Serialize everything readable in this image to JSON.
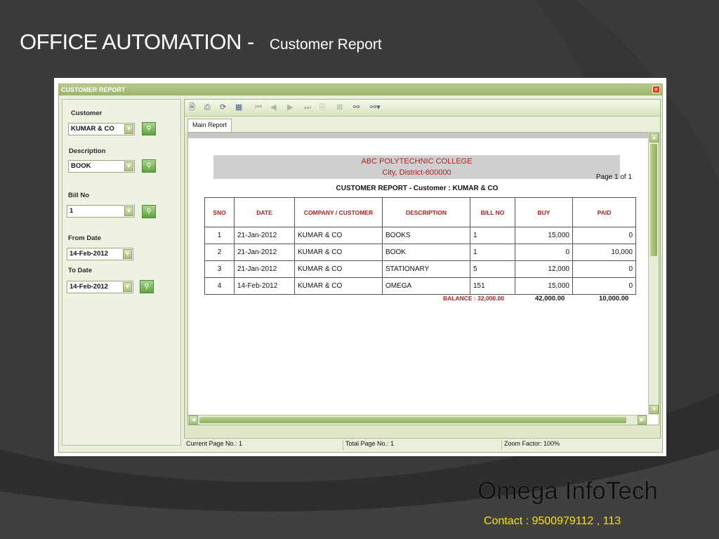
{
  "slide": {
    "title": "OFFICE AUTOMATION -",
    "subtitle": "Customer Report",
    "brand": "Omega  InfoTech",
    "contact": "Contact : 9500979112 , 113"
  },
  "window": {
    "title": "CUSTOMER REPORT",
    "close_glyph": "×"
  },
  "filters": {
    "customer_label": "Customer",
    "customer_value": "KUMAR & CO",
    "description_label": "Description",
    "description_value": "BOOK",
    "bill_no_label": "Bill No",
    "bill_no_value": "1",
    "from_date_label": "From Date",
    "from_date_value": "14-Feb-2012",
    "to_date_label": "To Date",
    "to_date_value": "14-Feb-2012"
  },
  "viewer": {
    "tab_label": "Main Report",
    "toolbar_icons": [
      "export-icon",
      "print-icon",
      "refresh-icon",
      "group-tree-icon",
      "first-page-icon",
      "prev-page-icon",
      "next-page-icon",
      "last-page-icon",
      "goto-page-icon",
      "close-view-icon",
      "search-icon",
      "zoom-icon"
    ]
  },
  "report": {
    "college": "ABC POLYTECHNIC COLLEGE",
    "address": "City, District-600000",
    "page_of": "Page 1 of 1",
    "subtitle": "CUSTOMER REPORT - Customer : KUMAR & CO",
    "columns": [
      "SNO",
      "DATE",
      "COMPANY / CUSTOMER",
      "DESCRIPTION",
      "BILL NO",
      "BUY",
      "PAID"
    ],
    "rows": [
      [
        "1",
        "21-Jan-2012",
        "KUMAR & CO",
        "BOOKS",
        "1",
        "15,000",
        "0"
      ],
      [
        "2",
        "21-Jan-2012",
        "KUMAR & CO",
        "BOOK",
        "1",
        "0",
        "10,000"
      ],
      [
        "3",
        "21-Jan-2012",
        "KUMAR & CO",
        "STATIONARY",
        "5",
        "12,000",
        "0"
      ],
      [
        "4",
        "14-Feb-2012",
        "KUMAR & CO",
        "OMEGA",
        "151",
        "15,000",
        "0"
      ]
    ],
    "balance": "BALANCE : 32,000.00",
    "total_buy": "42,000.00",
    "total_paid": "10,000.00"
  },
  "status": {
    "current_page": "Current Page No.: 1",
    "total_page": "Total Page No.: 1",
    "zoom": "Zoom Factor: 100%"
  },
  "colors": {
    "accent_red": "#b02020",
    "window_green": "#9db36a",
    "contact_yellow": "#f2e300"
  }
}
